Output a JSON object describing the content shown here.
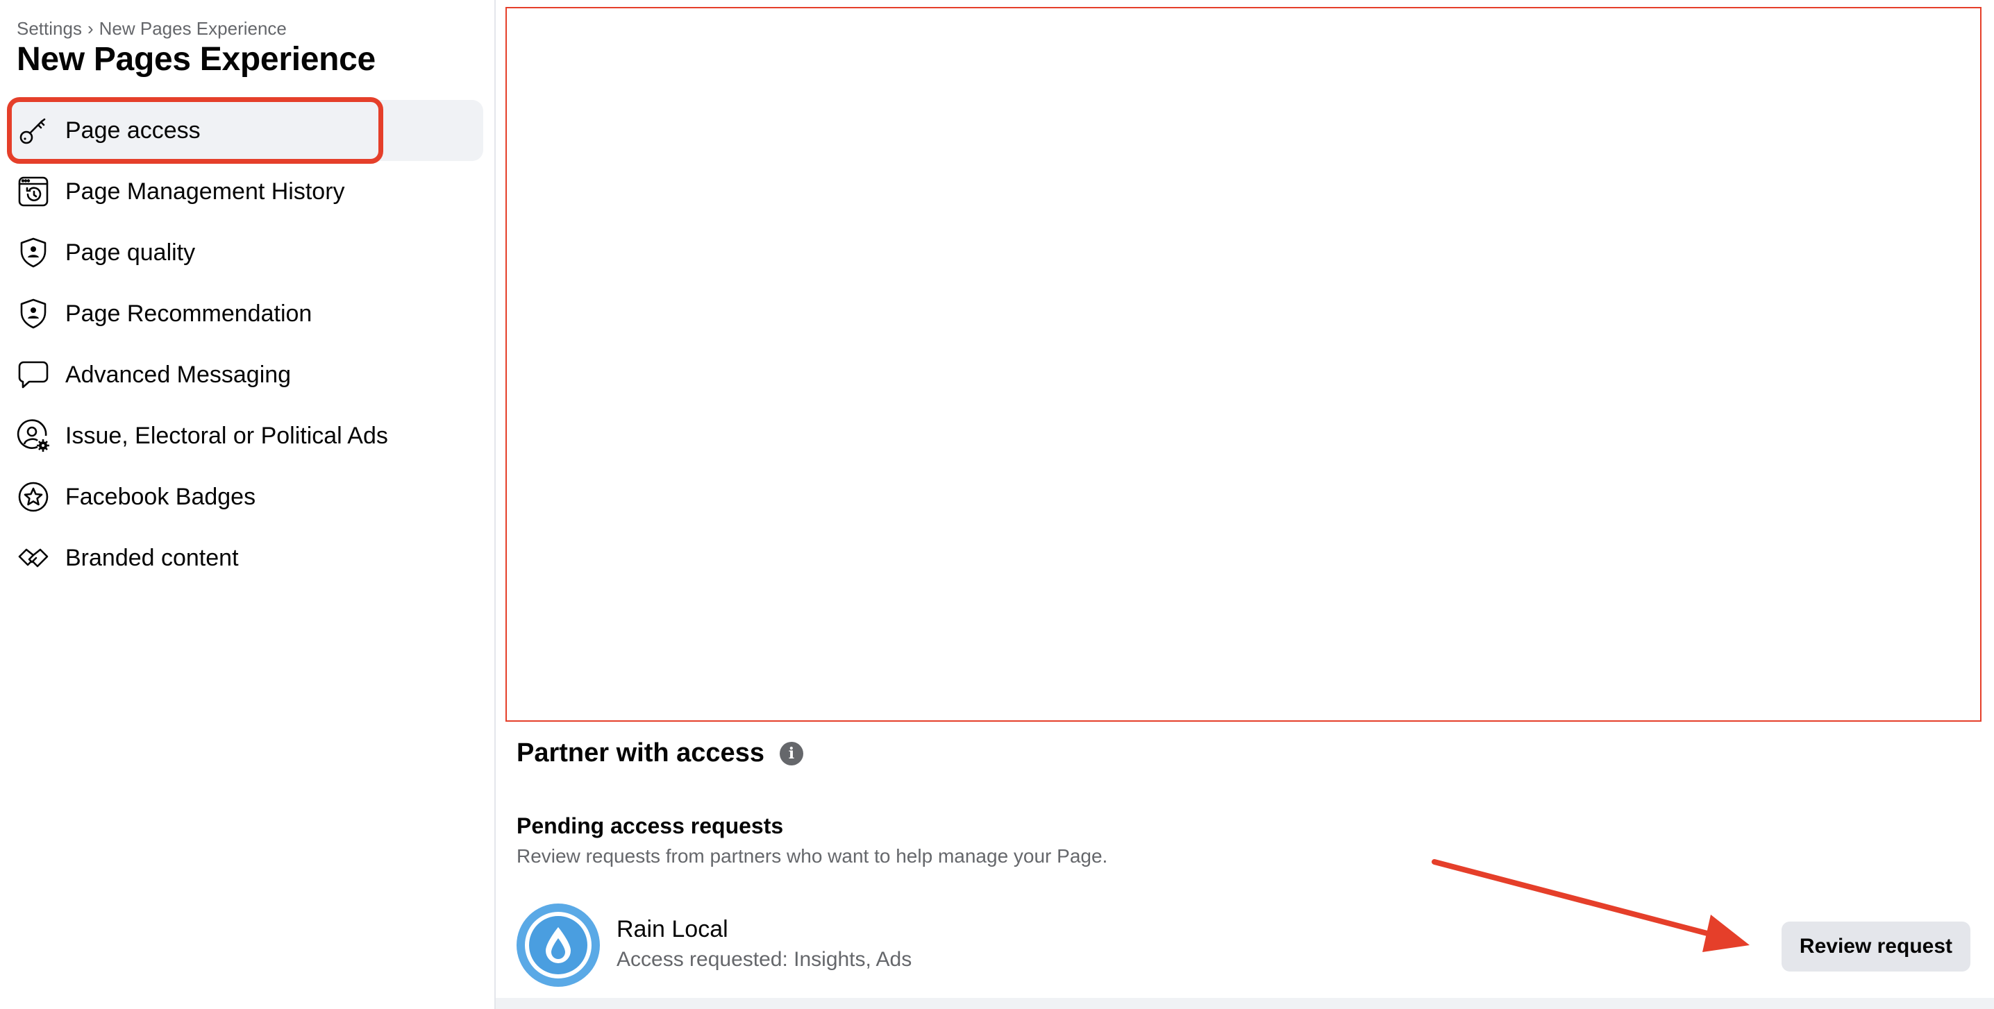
{
  "breadcrumb": {
    "root": "Settings",
    "separator": "›",
    "current": "New Pages Experience"
  },
  "page_title": "New Pages Experience",
  "sidebar": {
    "items": [
      {
        "label": "Page access",
        "icon": "key-icon",
        "active": true
      },
      {
        "label": "Page Management History",
        "icon": "history-icon",
        "active": false
      },
      {
        "label": "Page quality",
        "icon": "shield-person-icon",
        "active": false
      },
      {
        "label": "Page Recommendation",
        "icon": "shield-person-icon",
        "active": false
      },
      {
        "label": "Advanced Messaging",
        "icon": "chat-bubble-icon",
        "active": false
      },
      {
        "label": "Issue, Electoral or Political Ads",
        "icon": "person-gear-icon",
        "active": false
      },
      {
        "label": "Facebook Badges",
        "icon": "badge-star-icon",
        "active": false
      },
      {
        "label": "Branded content",
        "icon": "handshake-icon",
        "active": false
      }
    ]
  },
  "main": {
    "section_title": "Partner with access",
    "info_icon": "i",
    "pending": {
      "title": "Pending access requests",
      "description": "Review requests from partners who want to help manage your Page."
    },
    "request": {
      "partner_name": "Rain Local",
      "access_text": "Access requested: Insights, Ads",
      "button_label": "Review request"
    }
  },
  "colors": {
    "annotation_red": "#e53f2a",
    "active_bg": "#f0f2f5",
    "button_bg": "#e4e6eb",
    "secondary_text": "#65676b",
    "avatar_blue": "#4a9ee0"
  }
}
